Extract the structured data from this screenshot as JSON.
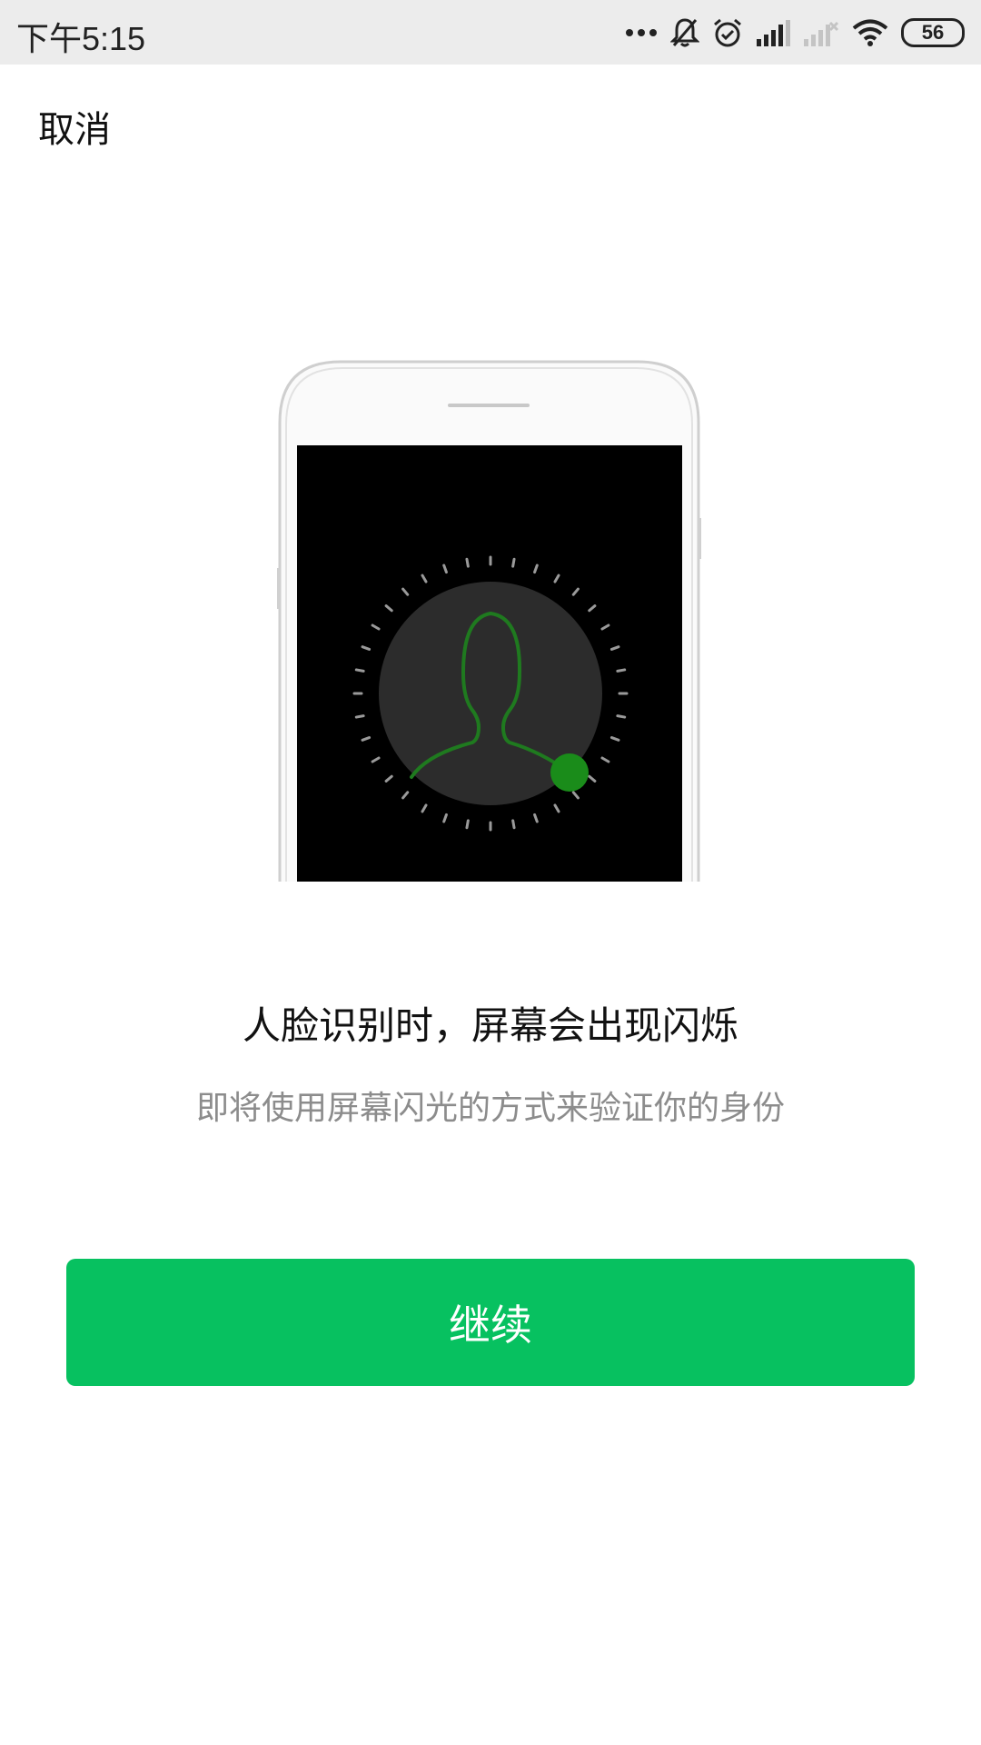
{
  "status_bar": {
    "time": "下午5:15",
    "battery": "56",
    "icons": [
      "more-dots-icon",
      "bell-off-icon",
      "alarm-icon",
      "signal-icon",
      "signal-no-service-icon",
      "wifi-icon",
      "battery-icon"
    ]
  },
  "nav": {
    "cancel_label": "取消"
  },
  "illustration": {
    "icon": "face-recognition-phone-icon"
  },
  "content": {
    "title": "人脸识别时，屏幕会出现闪烁",
    "subtitle": "即将使用屏幕闪光的方式来验证你的身份"
  },
  "actions": {
    "continue_label": "继续"
  },
  "colors": {
    "accent": "#07c160",
    "status_bar_bg": "#ececec",
    "subtitle_text": "#8c8c8c"
  }
}
